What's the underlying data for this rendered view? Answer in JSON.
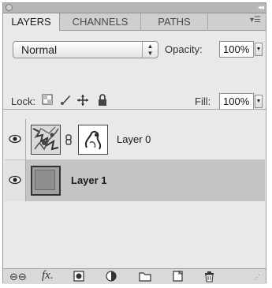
{
  "tabs": [
    {
      "label": "LAYERS"
    },
    {
      "label": "CHANNELS"
    },
    {
      "label": "PATHS"
    }
  ],
  "blend_mode": {
    "value": "Normal"
  },
  "opacity": {
    "label": "Opacity:",
    "value": "100%"
  },
  "lock": {
    "label": "Lock:"
  },
  "fill": {
    "label": "Fill:",
    "value": "100%"
  },
  "layers": [
    {
      "name": "Layer 0"
    },
    {
      "name": "Layer 1"
    }
  ]
}
